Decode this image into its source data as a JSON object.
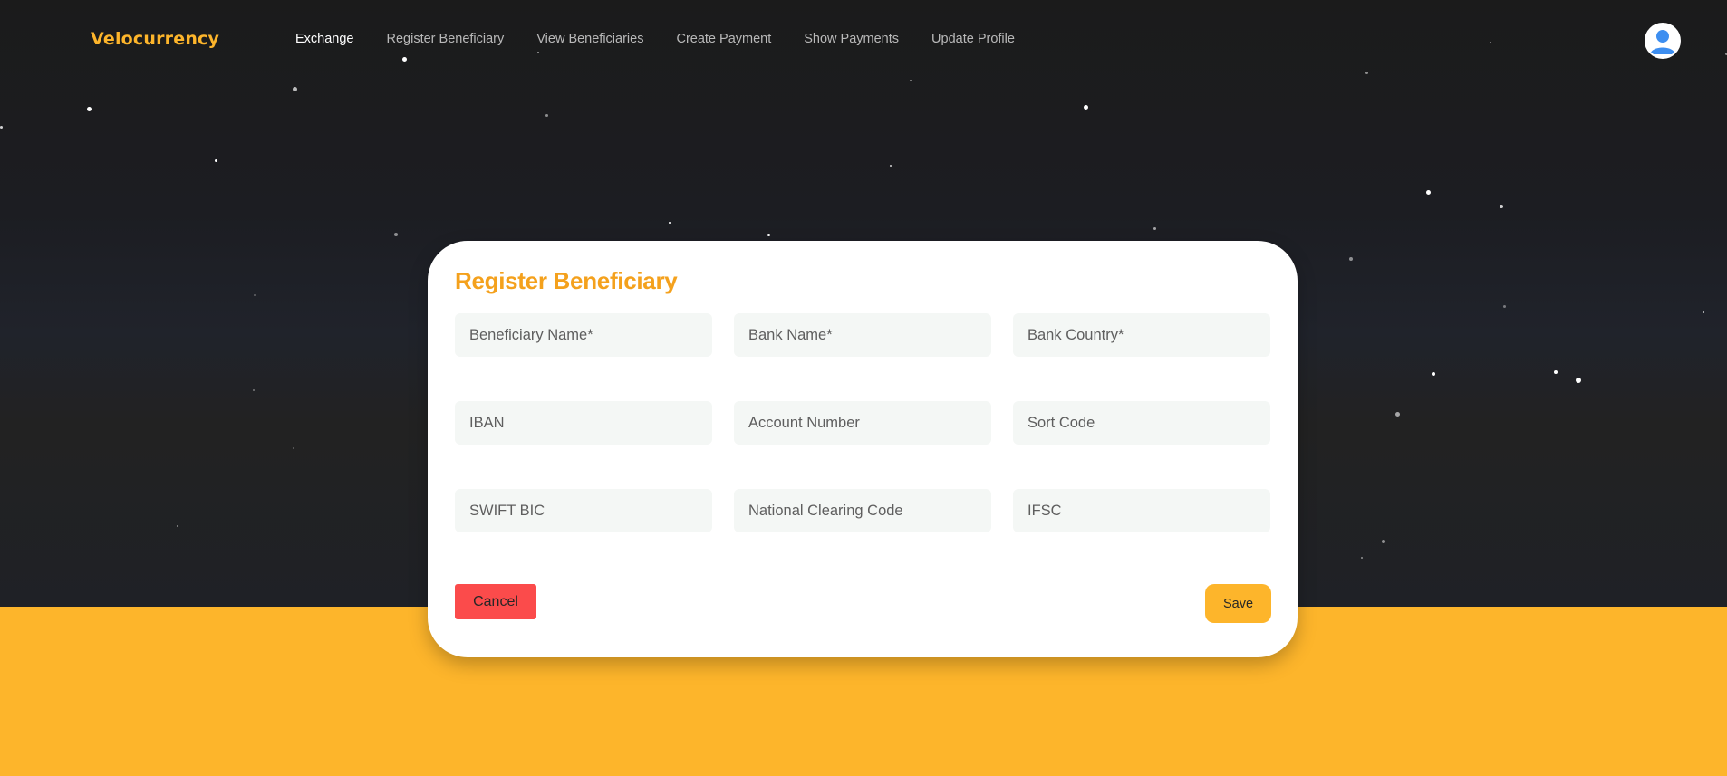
{
  "app": {
    "brand": "Velocurrency"
  },
  "nav": {
    "items": [
      {
        "label": "Exchange",
        "active": true
      },
      {
        "label": "Register Beneficiary",
        "active": false
      },
      {
        "label": "View Beneficiaries",
        "active": false
      },
      {
        "label": "Create Payment",
        "active": false
      },
      {
        "label": "Show Payments",
        "active": false
      },
      {
        "label": "Update Profile",
        "active": false
      }
    ],
    "avatar_icon": "user-avatar-icon"
  },
  "form": {
    "title": "Register Beneficiary",
    "fields": {
      "beneficiary_name": {
        "value": "",
        "placeholder": "Beneficiary Name*"
      },
      "bank_name": {
        "value": "",
        "placeholder": "Bank Name*"
      },
      "bank_country": {
        "value": "",
        "placeholder": "Bank Country*"
      },
      "iban": {
        "value": "",
        "placeholder": "IBAN"
      },
      "account_number": {
        "value": "",
        "placeholder": "Account Number"
      },
      "sort_code": {
        "value": "",
        "placeholder": "Sort Code"
      },
      "swift_bic": {
        "value": "",
        "placeholder": "SWIFT BIC"
      },
      "national_clearing_code": {
        "value": "",
        "placeholder": "National Clearing Code"
      },
      "ifsc": {
        "value": "",
        "placeholder": "IFSC"
      }
    },
    "cancel_label": "Cancel",
    "save_label": "Save"
  },
  "colors": {
    "brand": "#fdb52b",
    "title": "#f4a11d",
    "cancel": "#fb4b4b",
    "background_dark": "#1c1c1c",
    "background_accent": "#fdb52b",
    "avatar": "#3d8ef0"
  }
}
